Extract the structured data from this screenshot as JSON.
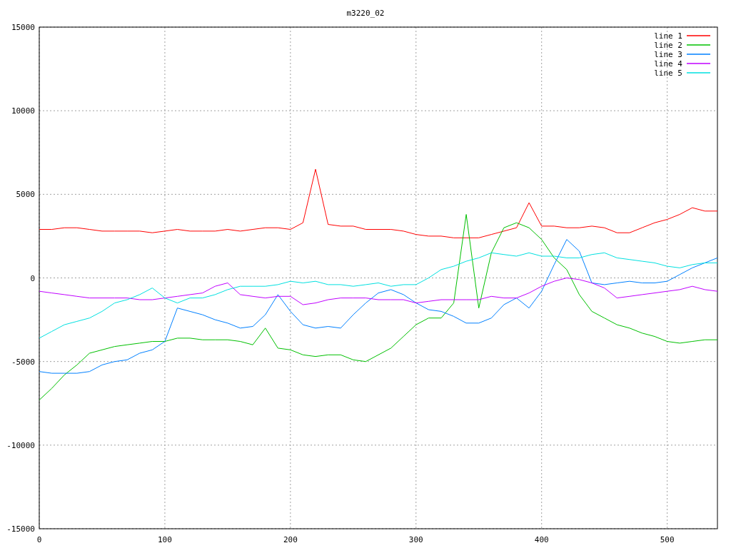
{
  "chart_data": {
    "type": "line",
    "title": "m3220_02",
    "grid": true,
    "legend": true,
    "x": [
      0,
      10,
      20,
      30,
      40,
      50,
      60,
      70,
      80,
      90,
      100,
      110,
      120,
      130,
      140,
      150,
      160,
      170,
      180,
      190,
      200,
      210,
      220,
      230,
      240,
      250,
      260,
      270,
      280,
      290,
      300,
      310,
      320,
      330,
      340,
      350,
      360,
      370,
      380,
      390,
      400,
      410,
      420,
      430,
      440,
      450,
      460,
      470,
      480,
      490,
      500,
      510,
      520,
      530,
      540
    ],
    "xlim": [
      0,
      540
    ],
    "ylim": [
      -15000,
      15000
    ],
    "xticks": [
      0,
      100,
      200,
      300,
      400,
      500
    ],
    "yticks": [
      -15000,
      -10000,
      -5000,
      0,
      5000,
      10000,
      15000
    ],
    "series": [
      {
        "name": "line 1",
        "color": "#ff0000",
        "values": [
          2900,
          2900,
          3000,
          3000,
          2900,
          2800,
          2800,
          2800,
          2800,
          2700,
          2800,
          2900,
          2800,
          2800,
          2800,
          2900,
          2800,
          2900,
          3000,
          3000,
          2900,
          3300,
          6500,
          3200,
          3100,
          3100,
          2900,
          2900,
          2900,
          2800,
          2600,
          2500,
          2500,
          2400,
          2400,
          2400,
          2600,
          2800,
          3000,
          4500,
          3100,
          3100,
          3000,
          3000,
          3100,
          3000,
          2700,
          2700,
          3000,
          3300,
          3500,
          3800,
          4200,
          4000,
          4000
        ]
      },
      {
        "name": "line 2",
        "color": "#00c000",
        "values": [
          -7300,
          -6600,
          -5800,
          -5200,
          -4500,
          -4300,
          -4100,
          -4000,
          -3900,
          -3800,
          -3800,
          -3600,
          -3600,
          -3700,
          -3700,
          -3700,
          -3800,
          -4000,
          -3000,
          -4200,
          -4300,
          -4600,
          -4700,
          -4600,
          -4600,
          -4900,
          -5000,
          -4600,
          -4200,
          -3500,
          -2800,
          -2400,
          -2400,
          -1500,
          3800,
          -1800,
          1500,
          3000,
          3300,
          3000,
          2300,
          1200,
          500,
          -1000,
          -2000,
          -2400,
          -2800,
          -3000,
          -3300,
          -3500,
          -3800,
          -3900,
          -3800,
          -3700,
          -3700
        ]
      },
      {
        "name": "line 3",
        "color": "#0080ff",
        "values": [
          -5600,
          -5700,
          -5700,
          -5700,
          -5600,
          -5200,
          -5000,
          -4900,
          -4500,
          -4300,
          -3800,
          -1800,
          -2000,
          -2200,
          -2500,
          -2700,
          -3000,
          -2900,
          -2200,
          -1000,
          -2000,
          -2800,
          -3000,
          -2900,
          -3000,
          -2200,
          -1500,
          -900,
          -700,
          -1000,
          -1500,
          -1900,
          -2000,
          -2300,
          -2700,
          -2700,
          -2400,
          -1600,
          -1200,
          -1800,
          -800,
          800,
          2300,
          1600,
          -300,
          -400,
          -300,
          -200,
          -300,
          -300,
          -200,
          200,
          600,
          900,
          1200
        ]
      },
      {
        "name": "line 4",
        "color": "#c000ff",
        "values": [
          -800,
          -900,
          -1000,
          -1100,
          -1200,
          -1200,
          -1200,
          -1200,
          -1300,
          -1300,
          -1200,
          -1100,
          -1000,
          -900,
          -500,
          -300,
          -1000,
          -1100,
          -1200,
          -1100,
          -1100,
          -1600,
          -1500,
          -1300,
          -1200,
          -1200,
          -1200,
          -1300,
          -1300,
          -1300,
          -1500,
          -1400,
          -1300,
          -1300,
          -1300,
          -1300,
          -1100,
          -1200,
          -1200,
          -900,
          -500,
          -200,
          0,
          -100,
          -300,
          -600,
          -1200,
          -1100,
          -1000,
          -900,
          -800,
          -700,
          -500,
          -700,
          -800
        ]
      },
      {
        "name": "line 5",
        "color": "#00e0e0",
        "values": [
          -3600,
          -3200,
          -2800,
          -2600,
          -2400,
          -2000,
          -1500,
          -1300,
          -1000,
          -600,
          -1200,
          -1500,
          -1200,
          -1200,
          -1000,
          -700,
          -500,
          -500,
          -500,
          -400,
          -200,
          -300,
          -200,
          -400,
          -400,
          -500,
          -400,
          -300,
          -500,
          -400,
          -400,
          0,
          500,
          700,
          1000,
          1200,
          1500,
          1400,
          1300,
          1500,
          1300,
          1300,
          1200,
          1200,
          1400,
          1500,
          1200,
          1100,
          1000,
          900,
          700,
          600,
          800,
          900,
          900
        ]
      }
    ]
  }
}
